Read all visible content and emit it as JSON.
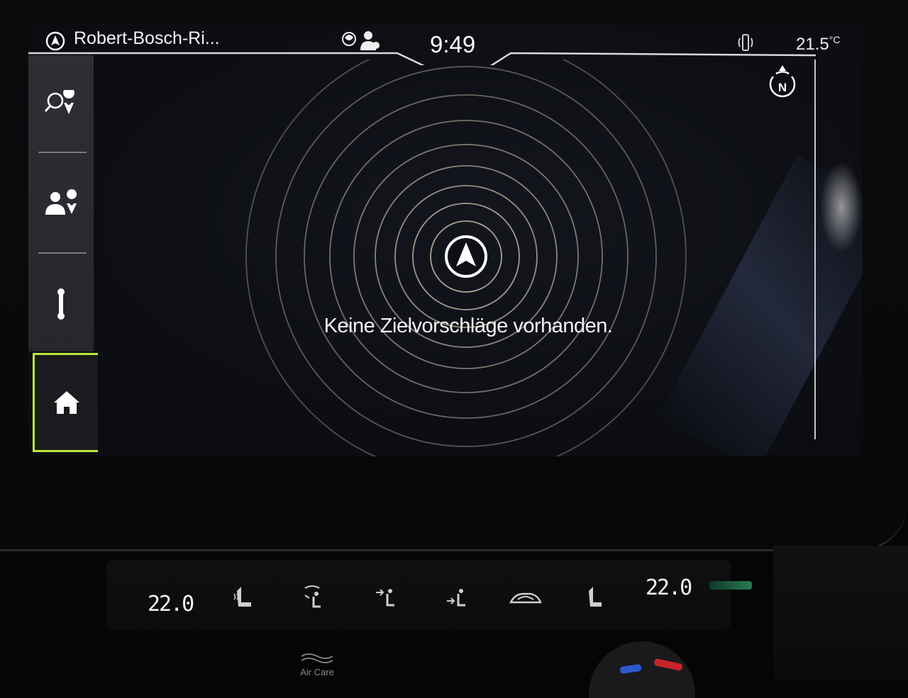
{
  "status_bar": {
    "location": "Robert-Bosch-Ri...",
    "time": "9:49",
    "outside_temp": "21.5",
    "outside_temp_unit": "°C"
  },
  "icons": {
    "nav": "navigation-arrow-icon",
    "online": "globe-icon",
    "profile": "user-profile-icon",
    "phone": "wireless-charging-icon",
    "compass": "compass-north-icon",
    "search": "search-destination-icon",
    "contacts": "contact-destination-icon",
    "route": "route-icon",
    "home": "home-icon"
  },
  "compass_label": "N",
  "main": {
    "message": "Keine Zielvorschläge vorhanden."
  },
  "climate": {
    "left_temp": "22.0",
    "right_temp": "22.0",
    "air_care_label": "Air Care"
  },
  "colors": {
    "accent": "#b8e83a",
    "ring": "#c8b9a8"
  }
}
